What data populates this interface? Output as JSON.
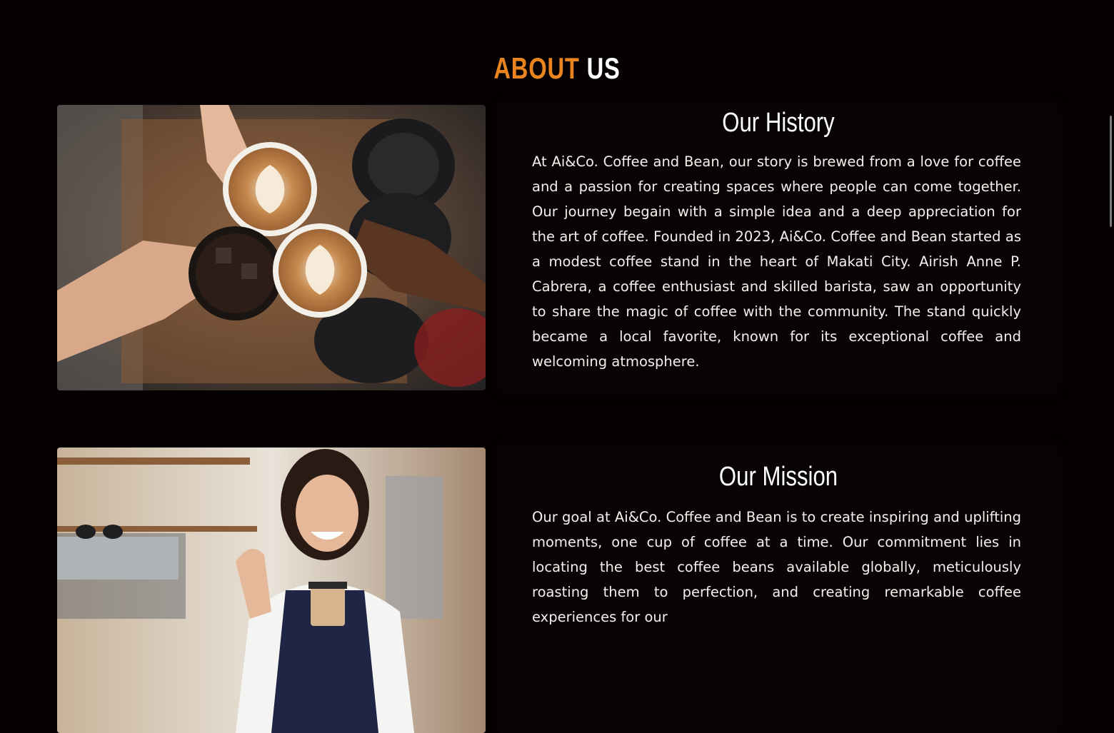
{
  "page": {
    "title_accent": "ABOUT",
    "title_rest": "US"
  },
  "history": {
    "heading": "Our History",
    "body": "At Ai&Co. Coffee and Bean, our story is brewed from a love for coffee and a passion for creating spaces where people can come together. Our journey begain with a simple idea and a deep appreciation for the art of coffee. Founded in 2023, Ai&Co. Coffee and Bean started as a modest coffee stand in the heart of Makati City. Airish Anne P. Cabrera, a coffee enthusiast and skilled barista, saw an opportunity to share the magic of coffee with the community. The stand quickly became a local favorite, known for its exceptional coffee and welcoming atmosphere.",
    "image": "coffee-cups-toast-photo"
  },
  "mission": {
    "heading": "Our Mission",
    "body": "Our goal at Ai&Co. Coffee and Bean is to create inspiring and uplifting moments, one cup of coffee at a time. Our commitment lies in locating the best coffee beans available globally, meticulously roasting them to perfection, and creating remarkable coffee experiences for our",
    "image": "smiling-barista-photo"
  },
  "colors": {
    "background": "#050103",
    "accent": "#e9841f",
    "text": "#f4f1ec"
  }
}
